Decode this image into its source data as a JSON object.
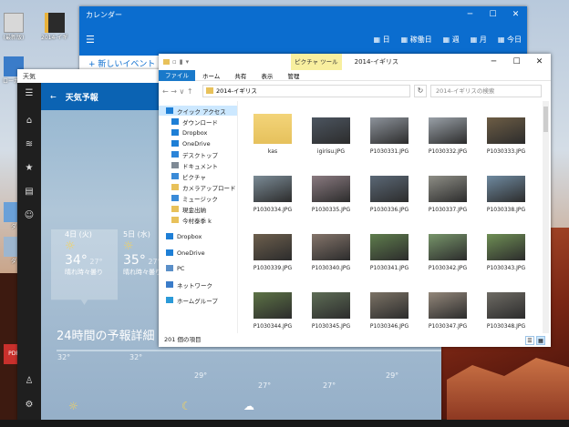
{
  "desktop": {
    "icons": [
      {
        "label": "(最新版)",
        "icon": "shortcut-icon"
      },
      {
        "label": "2014-イギリス",
        "icon": "book-icon"
      },
      {
        "label": "ローカル",
        "icon": "disk-icon"
      },
      {
        "label": "ダ",
        "icon": "app-icon"
      },
      {
        "label": "ダ",
        "icon": "app-icon"
      },
      {
        "label": "PDF",
        "icon": "pdf-icon"
      }
    ]
  },
  "calendar": {
    "title": "カレンダー",
    "menu_icon": "hamburger-icon",
    "new_event": "+ 新しいイベント",
    "views": [
      {
        "label": "日",
        "icon": "day-icon"
      },
      {
        "label": "稼働日",
        "icon": "workweek-icon"
      },
      {
        "label": "週",
        "icon": "week-icon"
      },
      {
        "label": "月",
        "icon": "month-icon"
      },
      {
        "label": "今日",
        "icon": "today-icon"
      }
    ],
    "controls": [
      "─",
      "☐",
      "✕"
    ]
  },
  "weather": {
    "window_title": "天気",
    "header": {
      "back": "←",
      "title": "天気予報"
    },
    "rail_icons": [
      "home-icon",
      "chart-icon",
      "star-icon",
      "news-icon",
      "smiley-icon",
      "user-icon",
      "gear-icon"
    ],
    "days": [
      {
        "label": "4日 (火)",
        "icon": "sun-icon",
        "high": "34°",
        "low": "27°",
        "cond": "晴れ時々曇り"
      },
      {
        "label": "5日 (水)",
        "icon": "sun-icon",
        "high": "35°",
        "low": "27°",
        "cond": "晴れ時々曇り"
      }
    ],
    "hourly_title": "24時間の予報詳細",
    "hourly": [
      "32°",
      "32°",
      "29°",
      "27°",
      "27°",
      "29°"
    ],
    "hourly_icons": [
      "sun-icon",
      "moon-icon",
      "cloud-icon"
    ]
  },
  "explorer": {
    "tabs": [
      "ファイル",
      "ホーム",
      "共有",
      "表示",
      "管理"
    ],
    "context_tab": "ピクチャ ツール",
    "window_title": "2014-イギリス",
    "controls": [
      "─",
      "☐",
      "✕"
    ],
    "nav": "← → ∨ ↑",
    "path": "2014-イギリス",
    "search_placeholder": "2014-イギリスの検索",
    "sidebar": [
      {
        "label": "クイック アクセス",
        "icon": "star-icon",
        "selected": true
      },
      {
        "label": "ダウンロード",
        "icon": "download-icon",
        "selected": false
      },
      {
        "label": "Dropbox",
        "icon": "dropbox-icon",
        "selected": false
      },
      {
        "label": "OneDrive",
        "icon": "onedrive-icon",
        "selected": false
      },
      {
        "label": "デスクトップ",
        "icon": "desktop-icon",
        "selected": false
      },
      {
        "label": "ドキュメント",
        "icon": "document-icon",
        "selected": false
      },
      {
        "label": "ピクチャ",
        "icon": "pictures-icon",
        "selected": false
      },
      {
        "label": "カメラアップロード",
        "icon": "folder-icon",
        "selected": false
      },
      {
        "label": "ミュージック",
        "icon": "music-icon",
        "selected": false
      },
      {
        "label": "現金出納",
        "icon": "folder-icon",
        "selected": false
      },
      {
        "label": "今村泰季 k",
        "icon": "folder-icon",
        "selected": false
      },
      {
        "label": "Dropbox",
        "icon": "dropbox-icon",
        "selected": false
      },
      {
        "label": "OneDrive",
        "icon": "onedrive-icon",
        "selected": false
      },
      {
        "label": "PC",
        "icon": "pc-icon",
        "selected": false
      },
      {
        "label": "ネットワーク",
        "icon": "network-icon",
        "selected": false
      },
      {
        "label": "ホームグループ",
        "icon": "homegroup-icon",
        "selected": false
      }
    ],
    "files": [
      {
        "name": "kas",
        "color": "#e6c15c"
      },
      {
        "name": "igirisu.JPG",
        "color": "#4c5560"
      },
      {
        "name": "P1030331.JPG",
        "color": "#8d939b"
      },
      {
        "name": "P1030332.JPG",
        "color": "#9aa1a8"
      },
      {
        "name": "P1030333.JPG",
        "color": "#6d5d45"
      },
      {
        "name": "P1030334.JPG",
        "color": "#7b8b96"
      },
      {
        "name": "P1030335.JPG",
        "color": "#8a7a80"
      },
      {
        "name": "P1030336.JPG",
        "color": "#5b6876"
      },
      {
        "name": "P1030337.JPG",
        "color": "#8e8e86"
      },
      {
        "name": "P1030338.JPG",
        "color": "#6f8aa0"
      },
      {
        "name": "P1030339.JPG",
        "color": "#6d5f4d"
      },
      {
        "name": "P1030340.JPG",
        "color": "#84746a"
      },
      {
        "name": "P1030341.JPG",
        "color": "#5f7d4d"
      },
      {
        "name": "P1030342.JPG",
        "color": "#77956a"
      },
      {
        "name": "P1030343.JPG",
        "color": "#6f8f55"
      },
      {
        "name": "P1030344.JPG",
        "color": "#5d7346"
      },
      {
        "name": "P1030345.JPG",
        "color": "#5e6d56"
      },
      {
        "name": "P1030346.JPG",
        "color": "#7b7265"
      },
      {
        "name": "P1030347.JPG",
        "color": "#93877a"
      },
      {
        "name": "P1030348.JPG",
        "color": "#6e6b64"
      }
    ],
    "status": "201 個の項目"
  }
}
